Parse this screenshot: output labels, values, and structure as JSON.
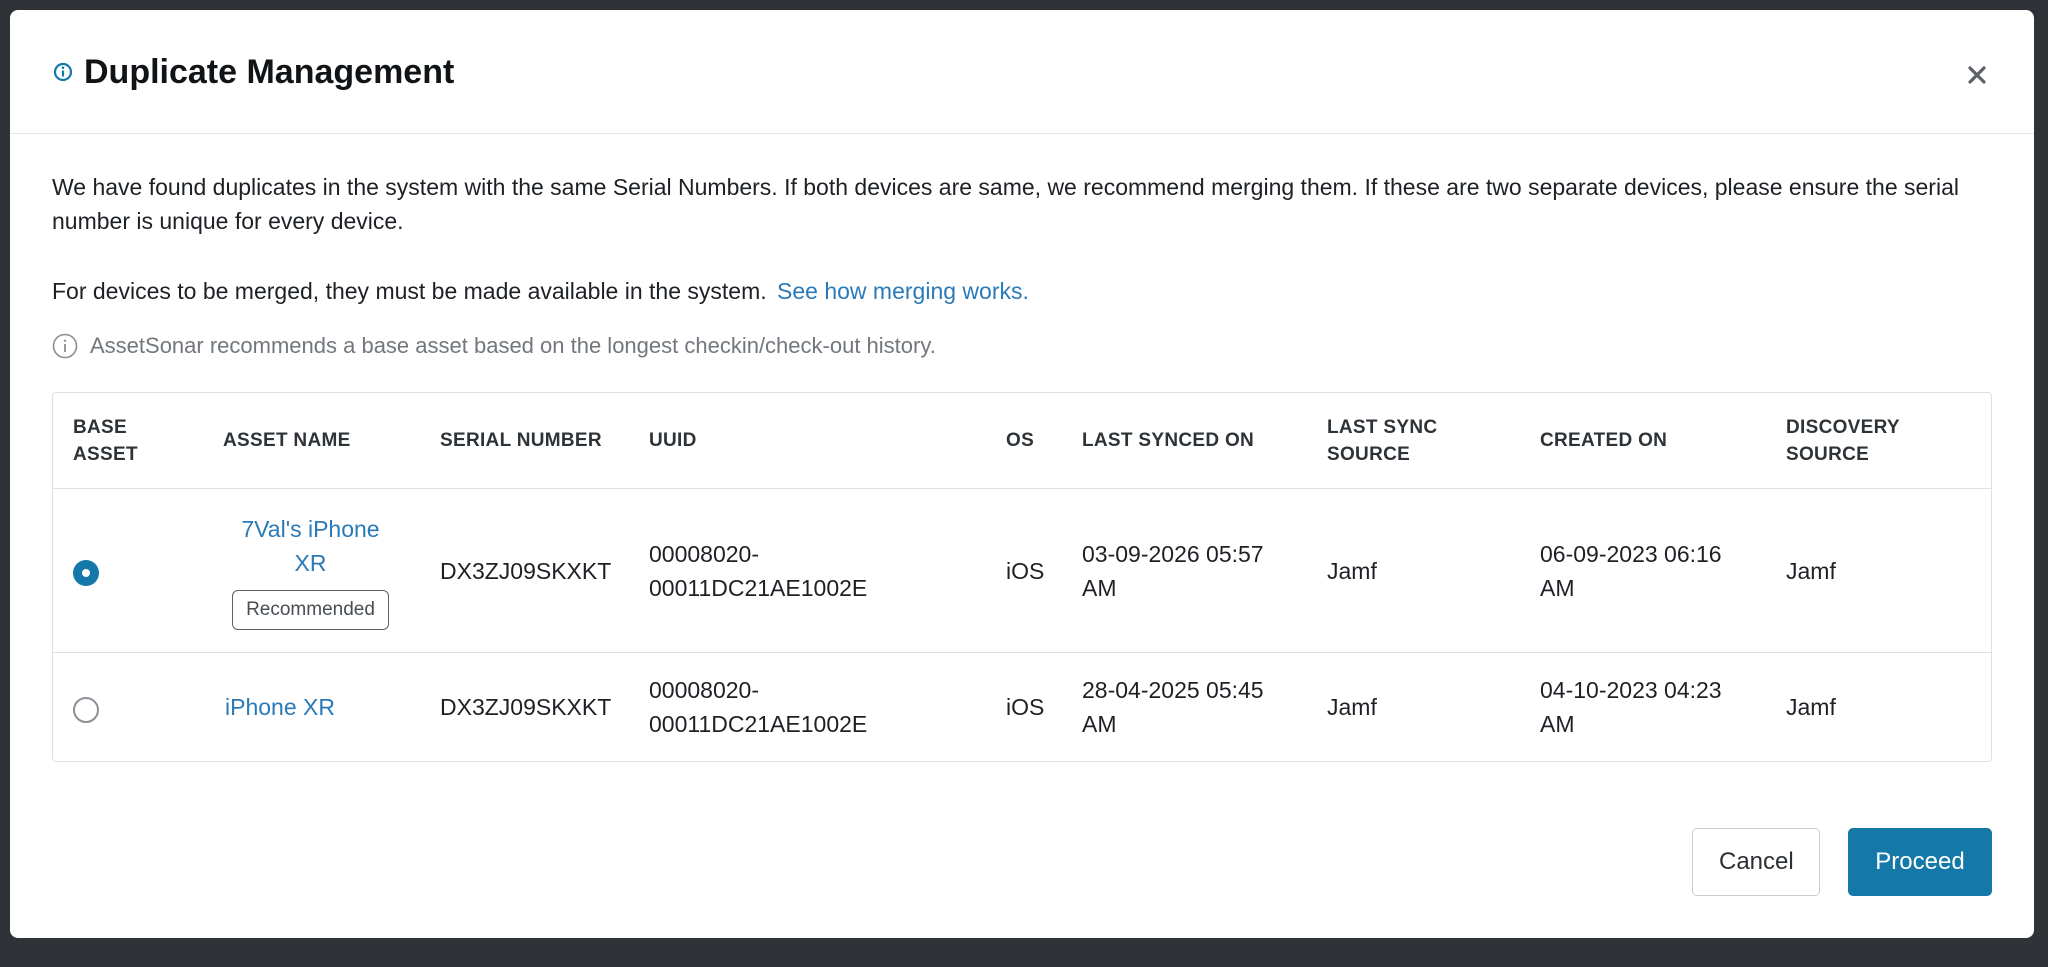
{
  "modal": {
    "title": "Duplicate Management",
    "description": "We have found duplicates in the system with the same Serial Numbers. If both devices are same, we recommend merging them. If these are two separate devices, please ensure the serial number is unique for every device.",
    "merge_text": "For devices to be merged, they must be made available in the system.",
    "merge_link": "See how merging works.",
    "info_text": "AssetSonar recommends a base asset based on the longest checkin/check-out history."
  },
  "table": {
    "headers": {
      "base_asset": "BASE ASSET",
      "asset_name": "ASSET NAME",
      "serial_number": "SERIAL NUMBER",
      "uuid": "UUID",
      "os": "OS",
      "last_synced_on": "LAST SYNCED ON",
      "last_sync_source": "LAST SYNC SOURCE",
      "created_on": "CREATED ON",
      "discovery_source": "DISCOVERY SOURCE"
    },
    "rows": [
      {
        "selected": true,
        "asset_name": "7Val's iPhone XR",
        "badge": "Recommended",
        "serial_number": "DX3ZJ09SKXKT",
        "uuid": "00008020-00011DC21AE1002E",
        "os": "iOS",
        "last_synced_on": "03-09-2026 05:57 AM",
        "last_sync_source": "Jamf",
        "created_on": "06-09-2023 06:16 AM",
        "discovery_source": "Jamf"
      },
      {
        "selected": false,
        "asset_name": "iPhone XR",
        "serial_number": "DX3ZJ09SKXKT",
        "uuid": "00008020-00011DC21AE1002E",
        "os": "iOS",
        "last_synced_on": "28-04-2025 05:45 AM",
        "last_sync_source": "Jamf",
        "created_on": "04-10-2023 04:23 AM",
        "discovery_source": "Jamf"
      }
    ]
  },
  "buttons": {
    "cancel": "Cancel",
    "proceed": "Proceed"
  },
  "icons": {
    "title": "info-icon",
    "close": "close-icon",
    "info": "info-circle-icon"
  },
  "colors": {
    "accent": "#1479a8",
    "link": "#2a7ab8"
  }
}
